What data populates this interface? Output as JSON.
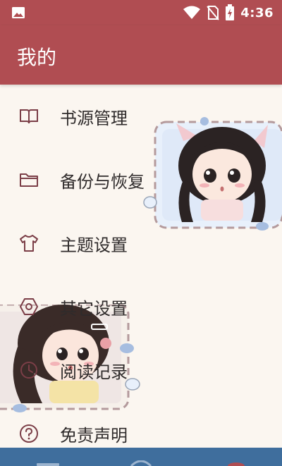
{
  "status_bar": {
    "time": "4:36"
  },
  "app_bar": {
    "title": "我的"
  },
  "menu": {
    "items": [
      {
        "label": "书源管理",
        "icon": "book-open-icon"
      },
      {
        "label": "备份与恢复",
        "icon": "folder-icon"
      },
      {
        "label": "主题设置",
        "icon": "t-shirt-icon"
      },
      {
        "label": "其它设置",
        "icon": "hexagon-settings-icon"
      },
      {
        "label": "阅读记录",
        "icon": "clock-icon"
      },
      {
        "label": "免责声明",
        "icon": "question-circle-icon"
      }
    ]
  },
  "colors": {
    "primary": "#b04d52",
    "background": "#fbf6f0",
    "bottom_bar": "#3f6e9d",
    "icon": "#7b3e47"
  }
}
